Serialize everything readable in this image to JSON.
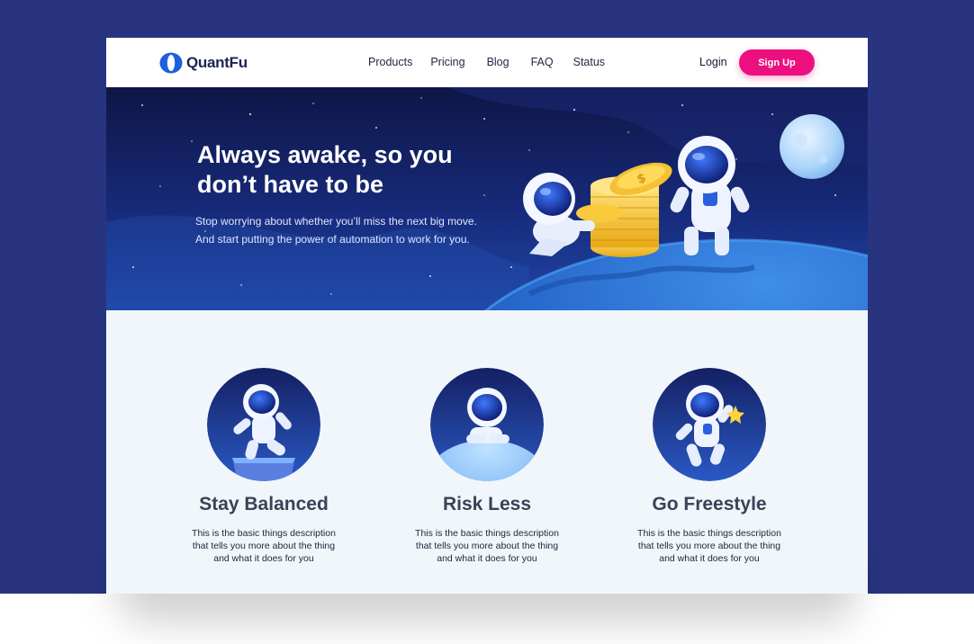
{
  "brand": {
    "name": "QuantFu"
  },
  "nav": {
    "links": [
      "Products",
      "Pricing",
      "Blog",
      "FAQ",
      "Status"
    ],
    "login": "Login",
    "signup": "Sign Up"
  },
  "hero": {
    "title": "Always awake, so you\ndon’t have to be",
    "subtitle": "Stop worrying about whether you’ll miss the next big move. And start putting the power of automation to work for you."
  },
  "features": [
    {
      "title": "Stay Balanced",
      "description": "This is the basic things description that tells you more about the thing and what it does for you",
      "icon": "astronaut-balancing-icon"
    },
    {
      "title": "Risk Less",
      "description": "This is the basic things description that tells you more about the thing and what it does for you",
      "icon": "astronaut-relaxing-icon"
    },
    {
      "title": "Go Freestyle",
      "description": "This is the basic things description that tells you more about the thing and what it does for you",
      "icon": "astronaut-star-icon"
    }
  ],
  "colors": {
    "backdrop": "#283480",
    "accent": "#ec0f7f",
    "hero_dark": "#101848",
    "page_bg": "#f1f6fb"
  }
}
